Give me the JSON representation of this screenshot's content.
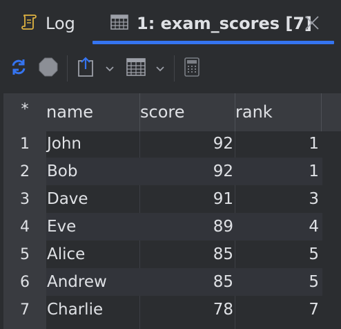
{
  "tabs": [
    {
      "label": "Log",
      "icon": "scroll-icon"
    },
    {
      "label": "1: exam_scores [7]",
      "icon": "table-icon",
      "active": true
    }
  ],
  "colors": {
    "accent": "#3574f0",
    "refresh": "#3574f0"
  },
  "toolbar": {
    "icons": [
      "refresh-icon",
      "stop-icon",
      "export-icon",
      "chevron-down-icon",
      "grid-view-icon",
      "chevron-down-icon",
      "calculator-icon"
    ]
  },
  "grid": {
    "corner": "*",
    "columns": [
      "name",
      "score",
      "rank"
    ],
    "rows": [
      {
        "n": "1",
        "name": "John",
        "score": "92",
        "rank": "1"
      },
      {
        "n": "2",
        "name": "Bob",
        "score": "92",
        "rank": "1"
      },
      {
        "n": "3",
        "name": "Dave",
        "score": "91",
        "rank": "3"
      },
      {
        "n": "4",
        "name": "Eve",
        "score": "89",
        "rank": "4"
      },
      {
        "n": "5",
        "name": "Alice",
        "score": "85",
        "rank": "5"
      },
      {
        "n": "6",
        "name": "Andrew",
        "score": "85",
        "rank": "5"
      },
      {
        "n": "7",
        "name": "Charlie",
        "score": "78",
        "rank": "7"
      }
    ]
  }
}
